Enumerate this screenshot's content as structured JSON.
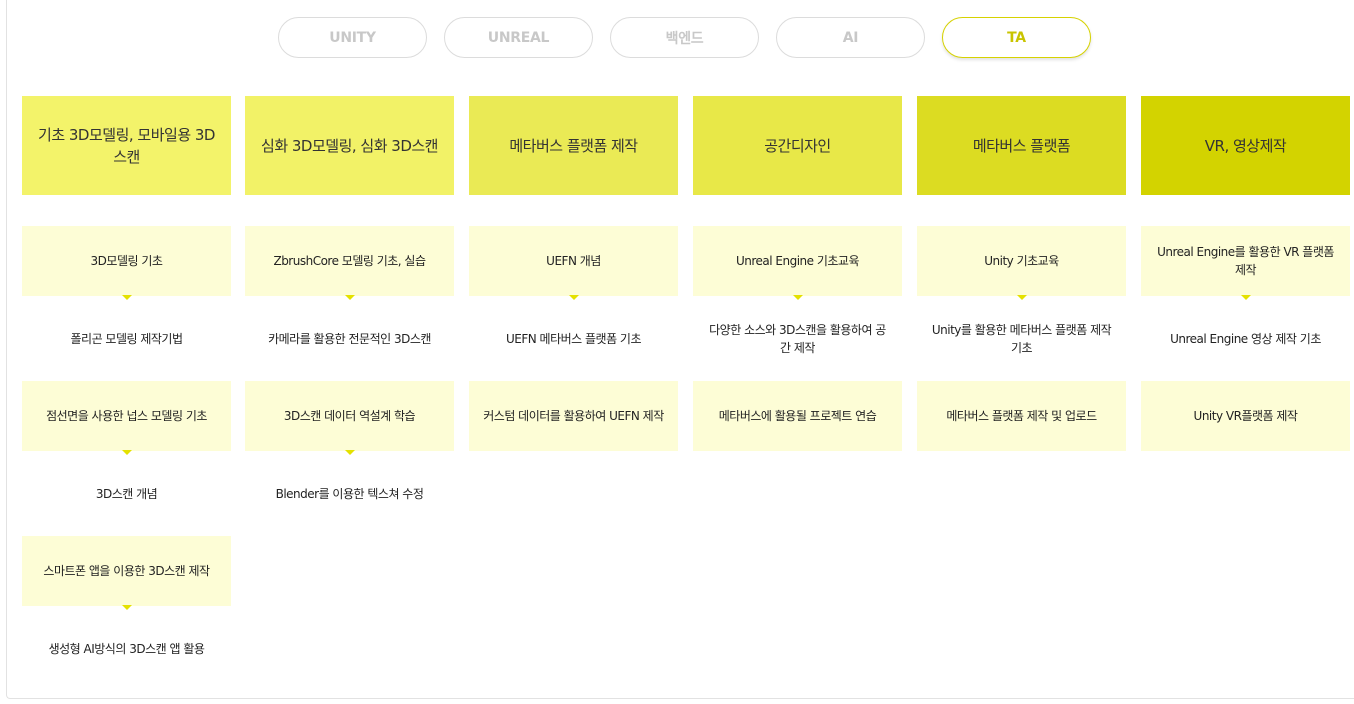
{
  "tabs": [
    {
      "label": "UNITY",
      "active": false
    },
    {
      "label": "UNREAL",
      "active": false
    },
    {
      "label": "백엔드",
      "active": false
    },
    {
      "label": "AI",
      "active": false
    },
    {
      "label": "TA",
      "active": true
    }
  ],
  "colors": {
    "accent": "#d6d200",
    "cell_box": "#fdfdd6",
    "arrow": "#e4e100",
    "header_shades": [
      "#f3f36a",
      "#f2f267",
      "#eaea55",
      "#e8e848",
      "#dcdc22",
      "#d3d300"
    ]
  },
  "columns": [
    {
      "header": "기초 3D모델링, 모바일용 3D스캔",
      "items": [
        "3D모델링 기초",
        "폴리곤 모델링 제작기법",
        "점선면을 사용한 넙스 모델링 기초",
        "3D스캔 개념",
        "스마트폰 앱을 이용한 3D스캔 제작",
        "생성형 AI방식의 3D스캔 앱 활용"
      ]
    },
    {
      "header": "심화 3D모델링, 심화 3D스캔",
      "items": [
        "ZbrushCore 모델링 기초, 실습",
        "카메라를 활용한 전문적인 3D스캔",
        "3D스캔 데이터 역설계 학습",
        "Blender를 이용한 텍스쳐 수정"
      ]
    },
    {
      "header": "메타버스 플랫폼 제작",
      "items": [
        "UEFN 개념",
        "UEFN 메타버스 플랫폼 기초",
        "커스텀 데이터를 활용하여 UEFN 제작"
      ]
    },
    {
      "header": "공간디자인",
      "items": [
        "Unreal Engine 기초교육",
        "다양한 소스와 3D스캔을 활용하여 공간 제작",
        "메타버스에 활용될 프로젝트 연습"
      ]
    },
    {
      "header": "메타버스 플랫폼",
      "items": [
        "Unity 기초교육",
        "Unity를 활용한 메타버스 플랫폼 제작 기초",
        "메타버스 플랫폼 제작 및 업로드"
      ]
    },
    {
      "header": "VR, 영상제작",
      "items": [
        "Unreal Engine를 활용한 VR 플랫폼 제작",
        "Unreal Engine 영상 제작 기초",
        "Unity VR플랫폼 제작"
      ]
    }
  ]
}
